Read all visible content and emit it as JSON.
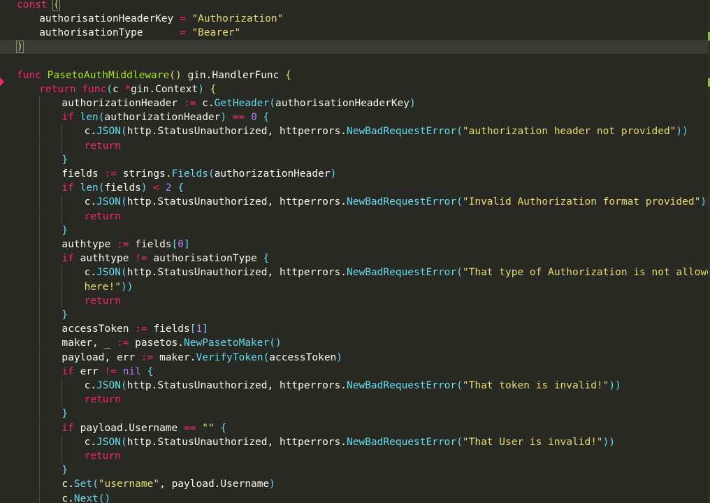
{
  "editor": {
    "language": "Go",
    "colors": {
      "background": "#282923",
      "keyword": "#f92672",
      "string": "#e6db74",
      "function_name": "#a6e22e",
      "method_call": "#66d9ef",
      "number": "#ae81ff",
      "identifier": "#f8f8f2",
      "current_line": "#3a3b33"
    },
    "current_line_index": 3,
    "lines": [
      {
        "indent": 0,
        "tokens": [
          [
            "kw",
            "const"
          ],
          [
            "pun",
            " "
          ],
          [
            "bm",
            "("
          ]
        ]
      },
      {
        "indent": 1,
        "tokens": [
          [
            "id",
            "authorisationHeaderKey"
          ],
          [
            "pun",
            " "
          ],
          [
            "op",
            "="
          ],
          [
            "pun",
            " "
          ],
          [
            "str",
            "\"Authorization\""
          ]
        ]
      },
      {
        "indent": 1,
        "tokens": [
          [
            "id",
            "authorisationType"
          ],
          [
            "pun",
            "      "
          ],
          [
            "op",
            "="
          ],
          [
            "pun",
            " "
          ],
          [
            "str",
            "\"Bearer\""
          ]
        ]
      },
      {
        "indent": 0,
        "tokens": [
          [
            "bm",
            ")"
          ]
        ]
      },
      {
        "indent": 0,
        "tokens": []
      },
      {
        "indent": 0,
        "tokens": [
          [
            "kw",
            "func"
          ],
          [
            "pun",
            " "
          ],
          [
            "func",
            "PasetoAuthMiddleware"
          ],
          [
            "brace",
            "()"
          ],
          [
            "pun",
            " "
          ],
          [
            "id",
            "gin.HandlerFunc"
          ],
          [
            "pun",
            " "
          ],
          [
            "brace",
            "{"
          ]
        ]
      },
      {
        "indent": 1,
        "tokens": [
          [
            "kw",
            "return"
          ],
          [
            "pun",
            " "
          ],
          [
            "kw",
            "func"
          ],
          [
            "par",
            "("
          ],
          [
            "id",
            "c"
          ],
          [
            "pun",
            " "
          ],
          [
            "op",
            "*"
          ],
          [
            "id",
            "gin.Context"
          ],
          [
            "par",
            ")"
          ],
          [
            "pun",
            " "
          ],
          [
            "brace",
            "{"
          ]
        ]
      },
      {
        "indent": 2,
        "tokens": [
          [
            "id",
            "authorizationHeader"
          ],
          [
            "pun",
            " "
          ],
          [
            "op",
            ":="
          ],
          [
            "pun",
            " "
          ],
          [
            "id",
            "c."
          ],
          [
            "call",
            "GetHeader"
          ],
          [
            "par",
            "("
          ],
          [
            "id",
            "authorisationHeaderKey"
          ],
          [
            "par",
            ")"
          ]
        ]
      },
      {
        "indent": 2,
        "tokens": [
          [
            "kw",
            "if"
          ],
          [
            "pun",
            " "
          ],
          [
            "call",
            "len"
          ],
          [
            "par",
            "("
          ],
          [
            "id",
            "authorizationHeader"
          ],
          [
            "par",
            ")"
          ],
          [
            "pun",
            " "
          ],
          [
            "op",
            "=="
          ],
          [
            "pun",
            " "
          ],
          [
            "num",
            "0"
          ],
          [
            "pun",
            " "
          ],
          [
            "call",
            "{"
          ]
        ]
      },
      {
        "indent": 3,
        "tokens": [
          [
            "id",
            "c."
          ],
          [
            "call",
            "JSON"
          ],
          [
            "par",
            "("
          ],
          [
            "id",
            "http.StatusUnauthorized, httperrors."
          ],
          [
            "call",
            "NewBadRequestError"
          ],
          [
            "par",
            "("
          ],
          [
            "str",
            "\"authorization header not provided\""
          ],
          [
            "par",
            "))"
          ]
        ]
      },
      {
        "indent": 3,
        "tokens": [
          [
            "kw",
            "return"
          ]
        ]
      },
      {
        "indent": 2,
        "tokens": [
          [
            "call",
            "}"
          ]
        ]
      },
      {
        "indent": 2,
        "tokens": [
          [
            "id",
            "fields"
          ],
          [
            "pun",
            " "
          ],
          [
            "op",
            ":="
          ],
          [
            "pun",
            " "
          ],
          [
            "id",
            "strings."
          ],
          [
            "call",
            "Fields"
          ],
          [
            "par",
            "("
          ],
          [
            "id",
            "authorizationHeader"
          ],
          [
            "par",
            ")"
          ]
        ]
      },
      {
        "indent": 2,
        "tokens": [
          [
            "kw",
            "if"
          ],
          [
            "pun",
            " "
          ],
          [
            "call",
            "len"
          ],
          [
            "par",
            "("
          ],
          [
            "id",
            "fields"
          ],
          [
            "par",
            ")"
          ],
          [
            "pun",
            " "
          ],
          [
            "op",
            "<"
          ],
          [
            "pun",
            " "
          ],
          [
            "num",
            "2"
          ],
          [
            "pun",
            " "
          ],
          [
            "call",
            "{"
          ]
        ]
      },
      {
        "indent": 3,
        "tokens": [
          [
            "id",
            "c."
          ],
          [
            "call",
            "JSON"
          ],
          [
            "par",
            "("
          ],
          [
            "id",
            "http.StatusUnauthorized, httperrors."
          ],
          [
            "call",
            "NewBadRequestError"
          ],
          [
            "par",
            "("
          ],
          [
            "str",
            "\"Invalid Authorization format provided\""
          ],
          [
            "par",
            "))"
          ]
        ]
      },
      {
        "indent": 3,
        "tokens": [
          [
            "kw",
            "return"
          ]
        ]
      },
      {
        "indent": 2,
        "tokens": [
          [
            "call",
            "}"
          ]
        ]
      },
      {
        "indent": 2,
        "tokens": [
          [
            "id",
            "authtype"
          ],
          [
            "pun",
            " "
          ],
          [
            "op",
            ":="
          ],
          [
            "pun",
            " "
          ],
          [
            "id",
            "fields"
          ],
          [
            "par",
            "["
          ],
          [
            "num",
            "0"
          ],
          [
            "par",
            "]"
          ]
        ]
      },
      {
        "indent": 2,
        "tokens": [
          [
            "kw",
            "if"
          ],
          [
            "pun",
            " "
          ],
          [
            "id",
            "authtype"
          ],
          [
            "pun",
            " "
          ],
          [
            "op",
            "!="
          ],
          [
            "pun",
            " "
          ],
          [
            "id",
            "authorisationType"
          ],
          [
            "pun",
            " "
          ],
          [
            "call",
            "{"
          ]
        ]
      },
      {
        "indent": 3,
        "tokens": [
          [
            "id",
            "c."
          ],
          [
            "call",
            "JSON"
          ],
          [
            "par",
            "("
          ],
          [
            "id",
            "http.StatusUnauthorized, httperrors."
          ],
          [
            "call",
            "NewBadRequestError"
          ],
          [
            "par",
            "("
          ],
          [
            "str",
            "\"That type of Authorization is not allowed"
          ]
        ]
      },
      {
        "indent": 3,
        "tokens": [
          [
            "str",
            "here!\""
          ],
          [
            "par",
            "))"
          ]
        ]
      },
      {
        "indent": 3,
        "tokens": [
          [
            "kw",
            "return"
          ]
        ]
      },
      {
        "indent": 2,
        "tokens": [
          [
            "call",
            "}"
          ]
        ]
      },
      {
        "indent": 2,
        "tokens": [
          [
            "id",
            "accessToken"
          ],
          [
            "pun",
            " "
          ],
          [
            "op",
            ":="
          ],
          [
            "pun",
            " "
          ],
          [
            "id",
            "fields"
          ],
          [
            "par",
            "["
          ],
          [
            "num",
            "1"
          ],
          [
            "par",
            "]"
          ]
        ]
      },
      {
        "indent": 2,
        "tokens": [
          [
            "id",
            "maker, _"
          ],
          [
            "pun",
            " "
          ],
          [
            "op",
            ":="
          ],
          [
            "pun",
            " "
          ],
          [
            "id",
            "pasetos."
          ],
          [
            "call",
            "NewPasetoMaker"
          ],
          [
            "par",
            "()"
          ]
        ]
      },
      {
        "indent": 2,
        "tokens": [
          [
            "id",
            "payload, err"
          ],
          [
            "pun",
            " "
          ],
          [
            "op",
            ":="
          ],
          [
            "pun",
            " "
          ],
          [
            "id",
            "maker."
          ],
          [
            "call",
            "VerifyToken"
          ],
          [
            "par",
            "("
          ],
          [
            "id",
            "accessToken"
          ],
          [
            "par",
            ")"
          ]
        ]
      },
      {
        "indent": 2,
        "tokens": [
          [
            "kw",
            "if"
          ],
          [
            "pun",
            " "
          ],
          [
            "id",
            "err"
          ],
          [
            "pun",
            " "
          ],
          [
            "op",
            "!="
          ],
          [
            "pun",
            " "
          ],
          [
            "num",
            "nil"
          ],
          [
            "pun",
            " "
          ],
          [
            "call",
            "{"
          ]
        ]
      },
      {
        "indent": 3,
        "tokens": [
          [
            "id",
            "c."
          ],
          [
            "call",
            "JSON"
          ],
          [
            "par",
            "("
          ],
          [
            "id",
            "http.StatusUnauthorized, httperrors."
          ],
          [
            "call",
            "NewBadRequestError"
          ],
          [
            "par",
            "("
          ],
          [
            "str",
            "\"That token is invalid!\""
          ],
          [
            "par",
            "))"
          ]
        ]
      },
      {
        "indent": 3,
        "tokens": [
          [
            "kw",
            "return"
          ]
        ]
      },
      {
        "indent": 2,
        "tokens": [
          [
            "call",
            "}"
          ]
        ]
      },
      {
        "indent": 2,
        "tokens": [
          [
            "kw",
            "if"
          ],
          [
            "pun",
            " "
          ],
          [
            "id",
            "payload.Username"
          ],
          [
            "pun",
            " "
          ],
          [
            "op",
            "=="
          ],
          [
            "pun",
            " "
          ],
          [
            "str",
            "\"\""
          ],
          [
            "pun",
            " "
          ],
          [
            "call",
            "{"
          ]
        ]
      },
      {
        "indent": 3,
        "tokens": [
          [
            "id",
            "c."
          ],
          [
            "call",
            "JSON"
          ],
          [
            "par",
            "("
          ],
          [
            "id",
            "http.StatusUnauthorized, httperrors."
          ],
          [
            "call",
            "NewBadRequestError"
          ],
          [
            "par",
            "("
          ],
          [
            "str",
            "\"That User is invalid!\""
          ],
          [
            "par",
            "))"
          ]
        ]
      },
      {
        "indent": 3,
        "tokens": [
          [
            "kw",
            "return"
          ]
        ]
      },
      {
        "indent": 2,
        "tokens": [
          [
            "call",
            "}"
          ]
        ]
      },
      {
        "indent": 2,
        "tokens": [
          [
            "id",
            "c."
          ],
          [
            "call",
            "Set"
          ],
          [
            "par",
            "("
          ],
          [
            "str",
            "\"username\""
          ],
          [
            "id",
            ", payload.Username"
          ],
          [
            "par",
            ")"
          ]
        ]
      },
      {
        "indent": 2,
        "tokens": [
          [
            "id",
            "c."
          ],
          [
            "call",
            "Next"
          ],
          [
            "par",
            "()"
          ]
        ]
      }
    ]
  }
}
